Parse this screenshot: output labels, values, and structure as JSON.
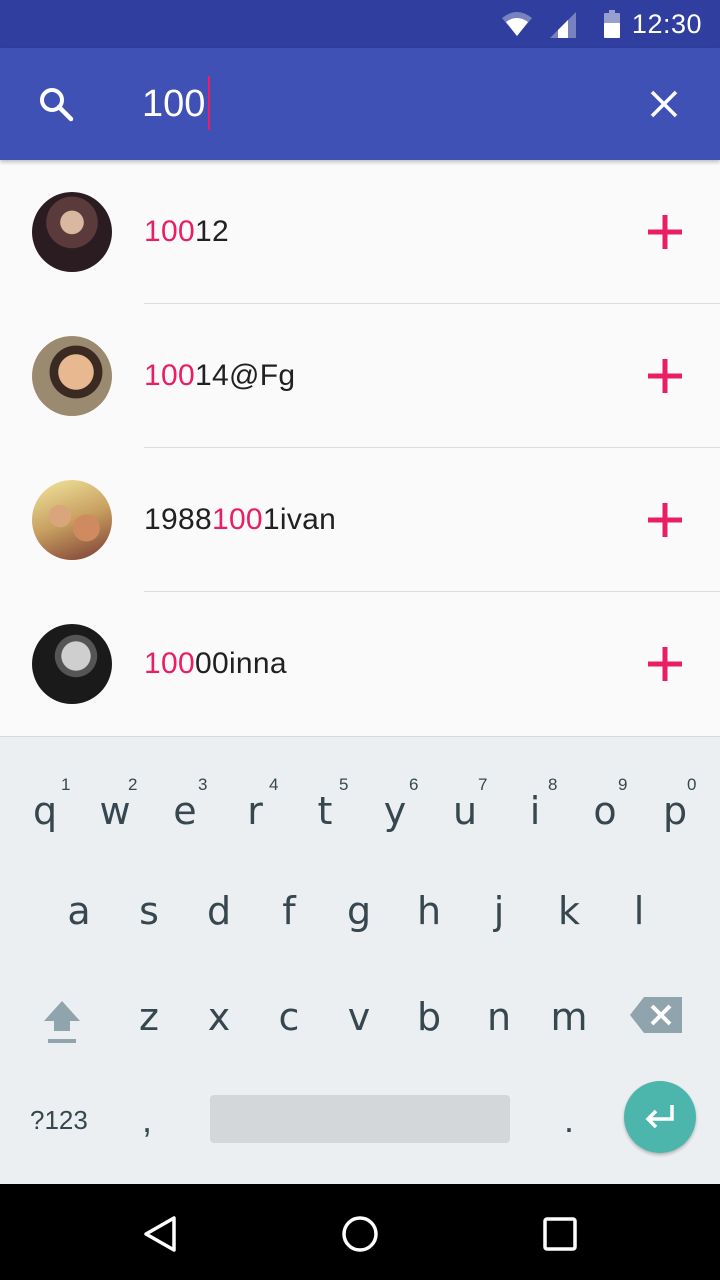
{
  "status_bar": {
    "time": "12:30",
    "icons": [
      "wifi-icon",
      "cell-signal-icon",
      "battery-icon"
    ]
  },
  "search": {
    "query": "100",
    "search_icon": "search-icon",
    "clear_icon": "close-icon"
  },
  "results": [
    {
      "prefix": "",
      "match": "100",
      "suffix": "12",
      "avatar_colors": [
        "#3a2a2a",
        "#7a5a4a"
      ],
      "action": "add-icon"
    },
    {
      "prefix": "",
      "match": "100",
      "suffix": "14@Fg",
      "avatar_colors": [
        "#6b5a40",
        "#c9a070"
      ],
      "action": "add-icon"
    },
    {
      "prefix": "1988",
      "match": "100",
      "suffix": "1ivan",
      "avatar_colors": [
        "#d8c27a",
        "#8a4a3a"
      ],
      "action": "add-icon"
    },
    {
      "prefix": "",
      "match": "100",
      "suffix": "00inna",
      "avatar_colors": [
        "#222222",
        "#bbbbbb"
      ],
      "action": "add-icon"
    }
  ],
  "keyboard": {
    "row1": [
      "q",
      "w",
      "e",
      "r",
      "t",
      "y",
      "u",
      "i",
      "o",
      "p"
    ],
    "row1_hints": [
      "1",
      "2",
      "3",
      "4",
      "5",
      "6",
      "7",
      "8",
      "9",
      "0"
    ],
    "row2": [
      "a",
      "s",
      "d",
      "f",
      "g",
      "h",
      "j",
      "k",
      "l"
    ],
    "row3": [
      "z",
      "x",
      "c",
      "v",
      "b",
      "n",
      "m"
    ],
    "symbols_key": "?123",
    "comma_key": ",",
    "period_key": "."
  },
  "nav_bar": {
    "buttons": [
      "back-icon",
      "home-icon",
      "recents-icon"
    ]
  },
  "colors": {
    "status_bar": "#303f9f",
    "app_bar": "#3f51b5",
    "accent": "#e91e63",
    "enter_key": "#4db6ac"
  }
}
